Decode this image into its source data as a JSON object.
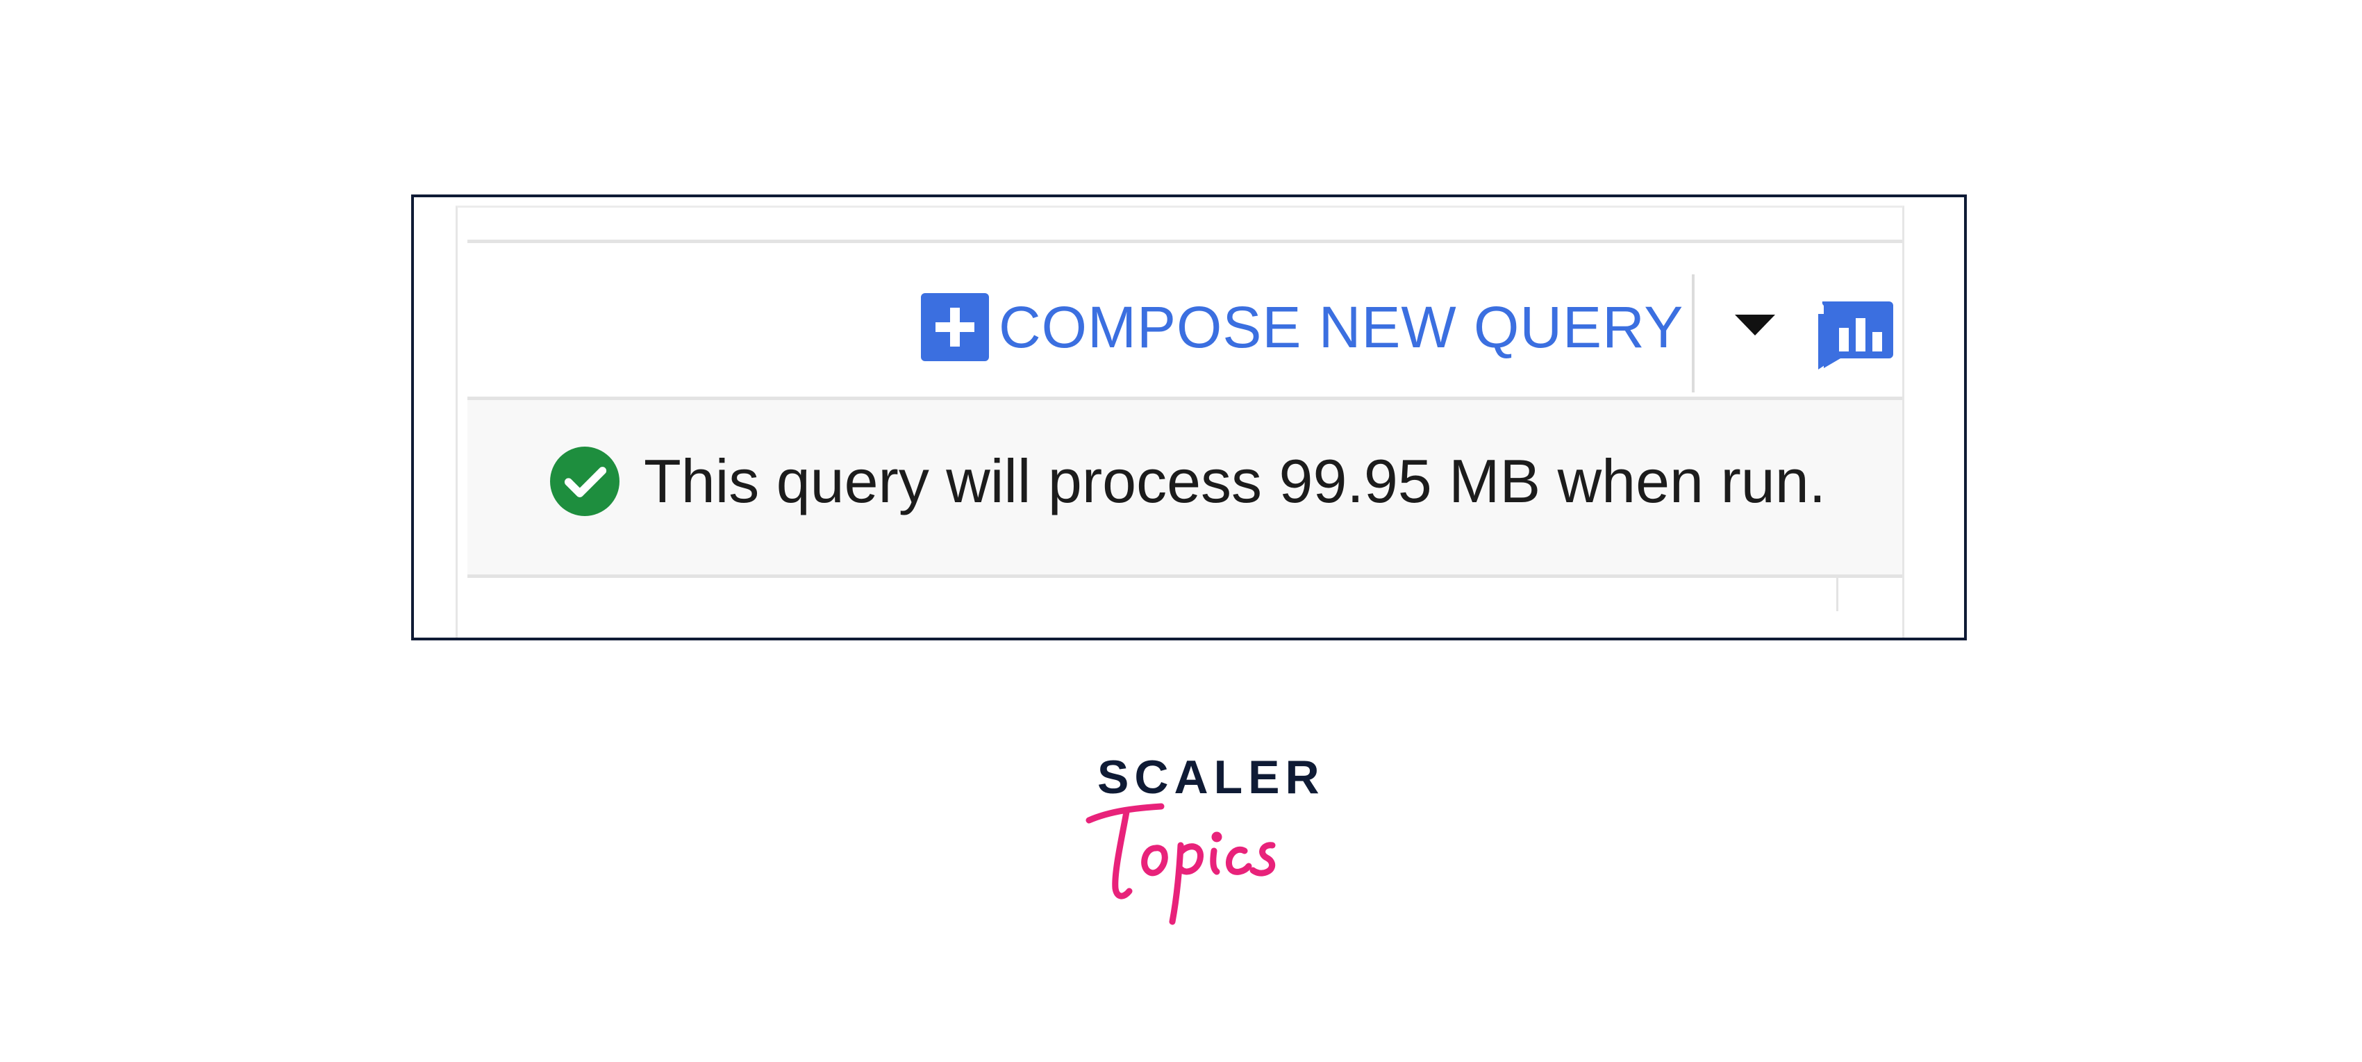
{
  "toolbar": {
    "compose_label": "COMPOSE NEW QUERY",
    "compose_icon": "plus-square-icon",
    "dropdown_icon": "caret-down-icon",
    "chart_icon": "query-chart-icon",
    "accent_color": "#3b6fe0"
  },
  "validator": {
    "icon": "check-circle-icon",
    "icon_color": "#1e8e3e",
    "message": "This query will process 99.95 MB when run."
  },
  "branding": {
    "line1": "SCALER",
    "line2": "Topics",
    "line1_color": "#0f1b35",
    "line2_color": "#e8227a"
  }
}
